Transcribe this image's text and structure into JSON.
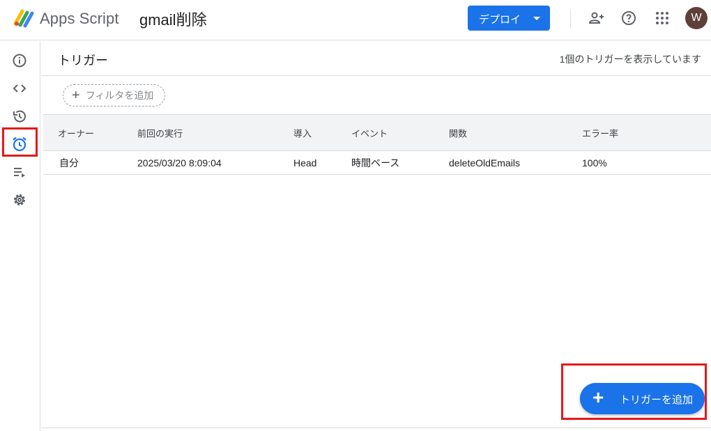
{
  "header": {
    "app_name": "Apps Script",
    "project_name": "gmail削除",
    "deploy_label": "デプロイ",
    "avatar_initial": "W",
    "icons": [
      "add-person-icon",
      "help-icon",
      "apps-grid-icon"
    ]
  },
  "rail": {
    "items": [
      {
        "name": "overview",
        "icon": "info-icon"
      },
      {
        "name": "editor",
        "icon": "code-icon"
      },
      {
        "name": "executions",
        "icon": "history-icon"
      },
      {
        "name": "triggers",
        "icon": "alarm-clock-icon",
        "active": true
      },
      {
        "name": "executions-list",
        "icon": "playlist-icon"
      },
      {
        "name": "settings",
        "icon": "gear-icon"
      }
    ]
  },
  "main": {
    "title": "トリガー",
    "trigger_count": "1個のトリガーを表示しています",
    "filter_label": "フィルタを追加",
    "columns": [
      "オーナー",
      "前回の実行",
      "導入",
      "イベント",
      "関数",
      "エラー率"
    ],
    "rows": [
      [
        "自分",
        "2025/03/20 8:09:04",
        "Head",
        "時間ベース",
        "deleteOldEmails",
        "100%"
      ]
    ],
    "add_trigger_label": "トリガーを追加"
  },
  "colors": {
    "accent": "#1a73e8",
    "highlight": "#e5191a",
    "avatar": "#5d4037"
  }
}
